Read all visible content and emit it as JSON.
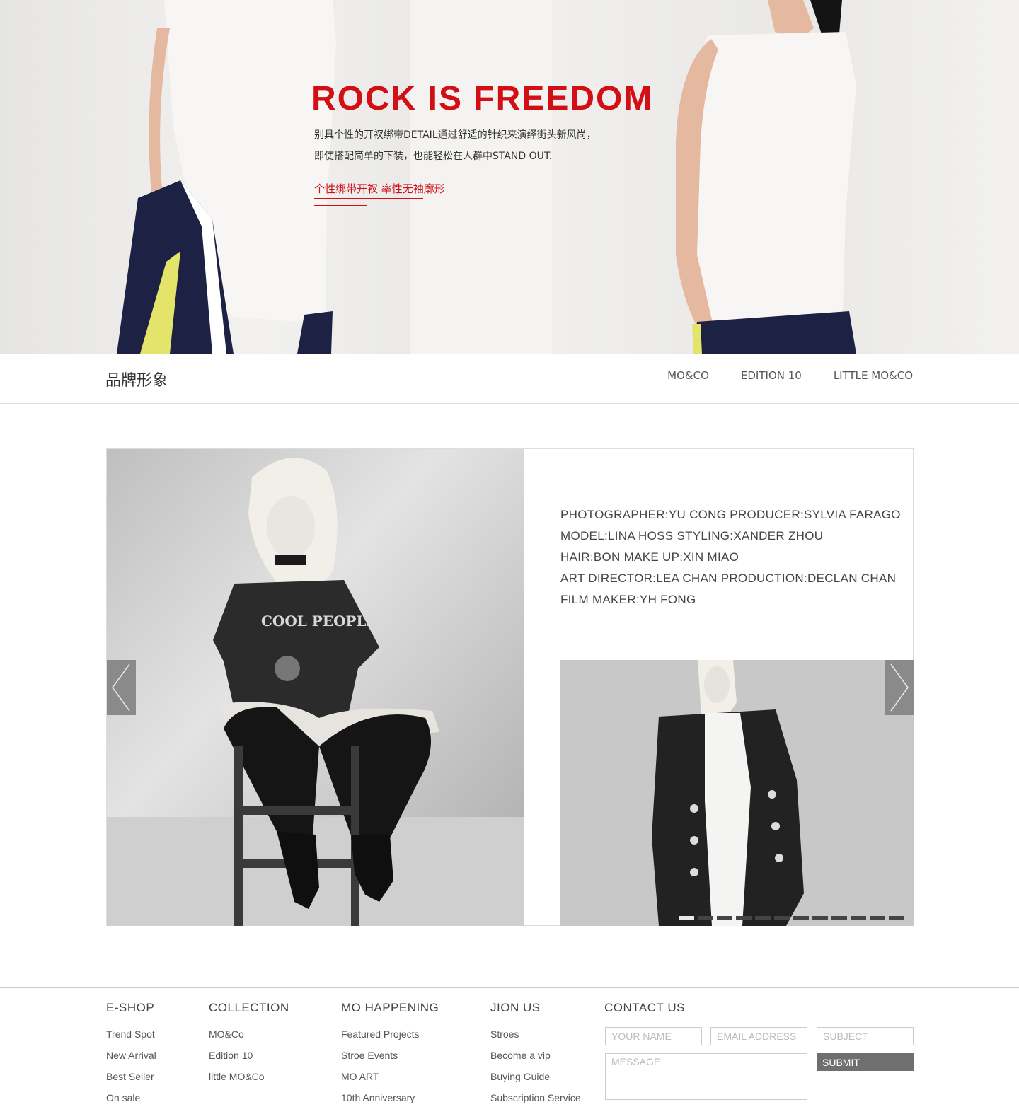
{
  "hero": {
    "title": "ROCK IS FREEDOM",
    "desc_line1": "别具个性的开衩绑带DETAIL通过舒适的针织来演绎街头新风尚，",
    "desc_line2": "即使搭配简单的下装，也能轻松在人群中STAND OUT.",
    "link": "个性绑带开衩 率性无袖廓形"
  },
  "subnav": {
    "brand": "品牌形象",
    "links": [
      "MO&CO",
      "EDITION 10",
      "LITTLE MO&CO"
    ]
  },
  "gallery": {
    "credits": [
      "PHOTOGRAPHER:YU CONG   PRODUCER:SYLVIA FARAGO",
      "MODEL:LINA HOSS  STYLING:XANDER ZHOU",
      "HAIR:BON   MAKE UP:XIN MIAO",
      "ART DIRECTOR:LEA CHAN    PRODUCTION:DECLAN CHAN",
      "FILM MAKER:YH FONG"
    ],
    "tee_text": "COOL PEOPLE",
    "slide_count": 12,
    "active_slide": 1
  },
  "footer": {
    "eshop": {
      "title": "E-SHOP",
      "items": [
        "Trend Spot",
        "New Arrival",
        "Best Seller",
        "On sale"
      ]
    },
    "collection": {
      "title": "COLLECTION",
      "items": [
        "MO&Co",
        "Edition 10",
        "little MO&Co"
      ]
    },
    "happening": {
      "title": "MO HAPPENING",
      "items": [
        "Featured Projects",
        "Stroe Events",
        "MO ART",
        "10th Anniversary"
      ]
    },
    "join": {
      "title": "JION US",
      "items": [
        "Stroes",
        "Become a vip",
        "Buying Guide",
        "Subscription Service"
      ]
    },
    "contact": {
      "title": "CONTACT US",
      "name_placeholder": "YOUR NAME",
      "email_placeholder": "EMAIL ADDRESS",
      "subject_placeholder": "SUBJECT",
      "message_placeholder": "MESSAGE",
      "submit": "SUBMIT"
    }
  },
  "colors": {
    "accent": "#d10f15",
    "arrow_bg": "#8a8a8a",
    "submit_bg": "#6f6f6f"
  }
}
